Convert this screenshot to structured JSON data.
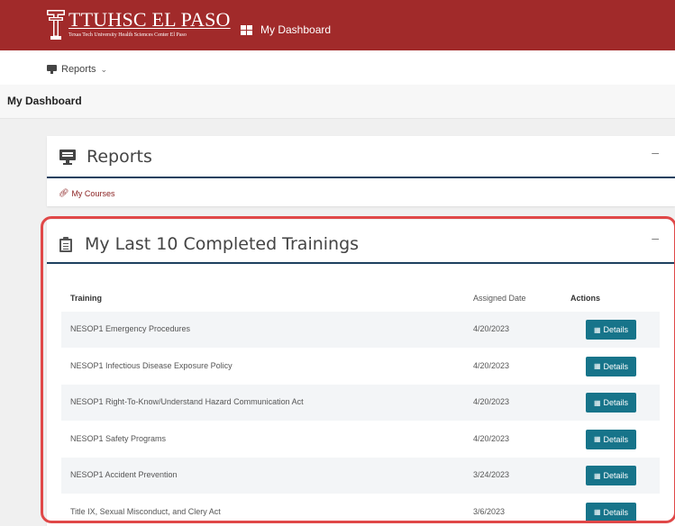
{
  "header": {
    "brand_name": "TTUHSC EL PASO",
    "brand_subtitle": "Texas Tech University Health Sciences Center El Paso",
    "nav_dashboard": "My Dashboard",
    "accent": "#a12a2a"
  },
  "subnav": {
    "reports_label": "Reports"
  },
  "breadcrumb": {
    "title": "My Dashboard"
  },
  "reports_card": {
    "title": "Reports",
    "collapse": "–",
    "link_label": "My Courses"
  },
  "trainings_card": {
    "title": "My Last 10 Completed Trainings",
    "collapse": "–",
    "columns": {
      "training": "Training",
      "assigned_date": "Assigned Date",
      "actions": "Actions"
    },
    "rows": [
      {
        "training": "NESOP1 Emergency Procedures",
        "date": "4/20/2023",
        "action": "Details"
      },
      {
        "training": "NESOP1 Infectious Disease Exposure Policy",
        "date": "4/20/2023",
        "action": "Details"
      },
      {
        "training": "NESOP1 Right-To-Know/Understand Hazard Communication Act",
        "date": "4/20/2023",
        "action": "Details"
      },
      {
        "training": "NESOP1 Safety Programs",
        "date": "4/20/2023",
        "action": "Details"
      },
      {
        "training": "NESOP1 Accident Prevention",
        "date": "3/24/2023",
        "action": "Details"
      },
      {
        "training": "Title IX, Sexual Misconduct, and Clery Act",
        "date": "3/6/2023",
        "action": "Details"
      }
    ],
    "button_color": "#17748a"
  }
}
